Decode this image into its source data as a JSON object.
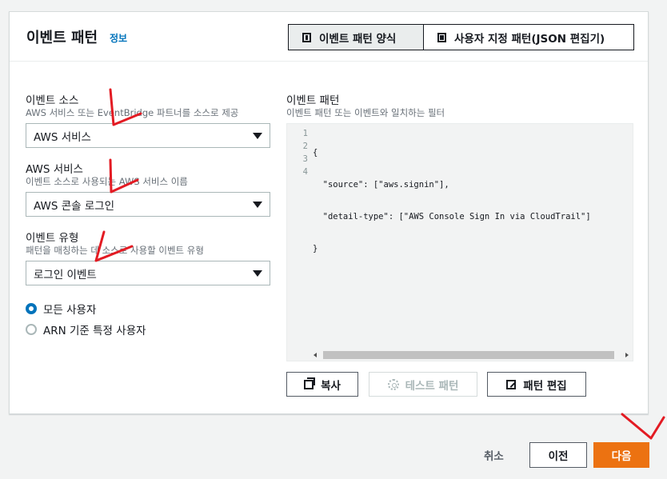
{
  "header": {
    "title": "이벤트 패턴",
    "info_link": "정보",
    "mode_tabs": [
      {
        "label": "이벤트 패턴 양식",
        "active": true
      },
      {
        "label": "사용자 지정 패턴(JSON 편집기)",
        "active": false
      }
    ]
  },
  "form": {
    "event_source": {
      "label": "이벤트 소스",
      "description": "AWS 서비스 또는 EventBridge 파트너를 소스로 제공",
      "value": "AWS 서비스"
    },
    "aws_service": {
      "label": "AWS 서비스",
      "description": "이벤트 소스로 사용되는 AWS 서비스 이름",
      "value": "AWS 콘솔 로그인"
    },
    "event_type": {
      "label": "이벤트 유형",
      "description": "패턴을 매칭하는 데 소스로 사용할 이벤트 유형",
      "value": "로그인 이벤트"
    },
    "user_options": [
      {
        "label": "모든 사용자",
        "selected": true
      },
      {
        "label": "ARN 기준 특정 사용자",
        "selected": false
      }
    ]
  },
  "pattern": {
    "label": "이벤트 패턴",
    "description": "이벤트 패턴 또는 이벤트와 일치하는 필터",
    "line_numbers": [
      "1",
      "2",
      "3",
      "4"
    ],
    "code_lines": [
      "{",
      "  \"source\": [\"aws.signin\"],",
      "  \"detail-type\": [\"AWS Console Sign In via CloudTrail\"]",
      "}"
    ],
    "buttons": {
      "copy": "복사",
      "test": "테스트 패턴",
      "edit": "패턴 편집"
    }
  },
  "footer": {
    "cancel": "취소",
    "previous": "이전",
    "next": "다음"
  },
  "colors": {
    "accent": "#0073bb",
    "primary_button": "#ec7211",
    "annotation_marks": "#e31b23"
  }
}
